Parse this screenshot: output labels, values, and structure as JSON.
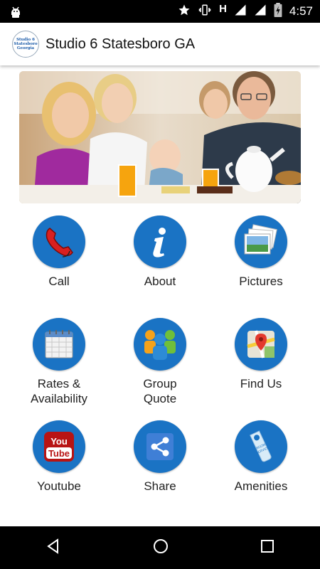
{
  "status_bar": {
    "time": "4:57",
    "network_letter": "H"
  },
  "app_bar": {
    "title": "Studio 6 Statesboro GA",
    "logo_text": [
      "Studio 6",
      "Statesboro",
      "Georgia"
    ]
  },
  "menu": [
    {
      "label": "Call",
      "icon": "phone-icon"
    },
    {
      "label": "About",
      "icon": "info-icon"
    },
    {
      "label": "Pictures",
      "icon": "photos-icon"
    },
    {
      "label": "Rates &\nAvailability",
      "icon": "calendar-icon"
    },
    {
      "label": "Group\nQuote",
      "icon": "group-icon"
    },
    {
      "label": "Find Us",
      "icon": "map-icon"
    },
    {
      "label": "Youtube",
      "icon": "youtube-icon"
    },
    {
      "label": "Share",
      "icon": "share-icon"
    },
    {
      "label": "Amenities",
      "icon": "room-service-tag-icon"
    }
  ],
  "youtube_logo": [
    "You",
    "Tube"
  ],
  "amenities_tag_text": [
    "ROOM",
    "SERVICE"
  ],
  "colors": {
    "accent": "#1a73c4",
    "status_bar": "#000000",
    "nav_bar": "#000000"
  }
}
